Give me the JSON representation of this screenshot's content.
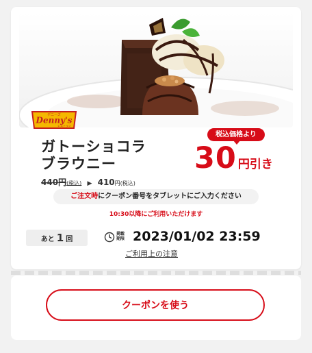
{
  "brand": {
    "logo_text": "Denny's",
    "logo_top_text": "デニーズ",
    "logo_bottom_text": "レストラン"
  },
  "product": {
    "name_line1": "ガトーショコラ",
    "name_line2": "ブラウニー",
    "old_price": "440円",
    "old_price_tax": "(税込)",
    "new_price": "410",
    "new_price_unit": "円",
    "new_price_tax": "(税込)"
  },
  "discount": {
    "badge": "税込価格より",
    "amount": "30",
    "unit": "円引き"
  },
  "notice": {
    "highlight": "ご注文時",
    "rest": "にクーポン番号をタブレットにご入力ください",
    "time_note": "10:30以降にご利用いただけます"
  },
  "usage": {
    "prefix": "あと",
    "count": "1",
    "suffix": "回"
  },
  "deadline": {
    "label_line1": "掲載",
    "label_line2": "期限",
    "datetime": "2023/01/02 23:59"
  },
  "links": {
    "notes": "ご利用上の注意"
  },
  "action": {
    "use_coupon": "クーポンを使う"
  },
  "colors": {
    "accent": "#d70c18",
    "background": "#f2f2f2"
  },
  "icons": {
    "clock": "clock-icon"
  }
}
